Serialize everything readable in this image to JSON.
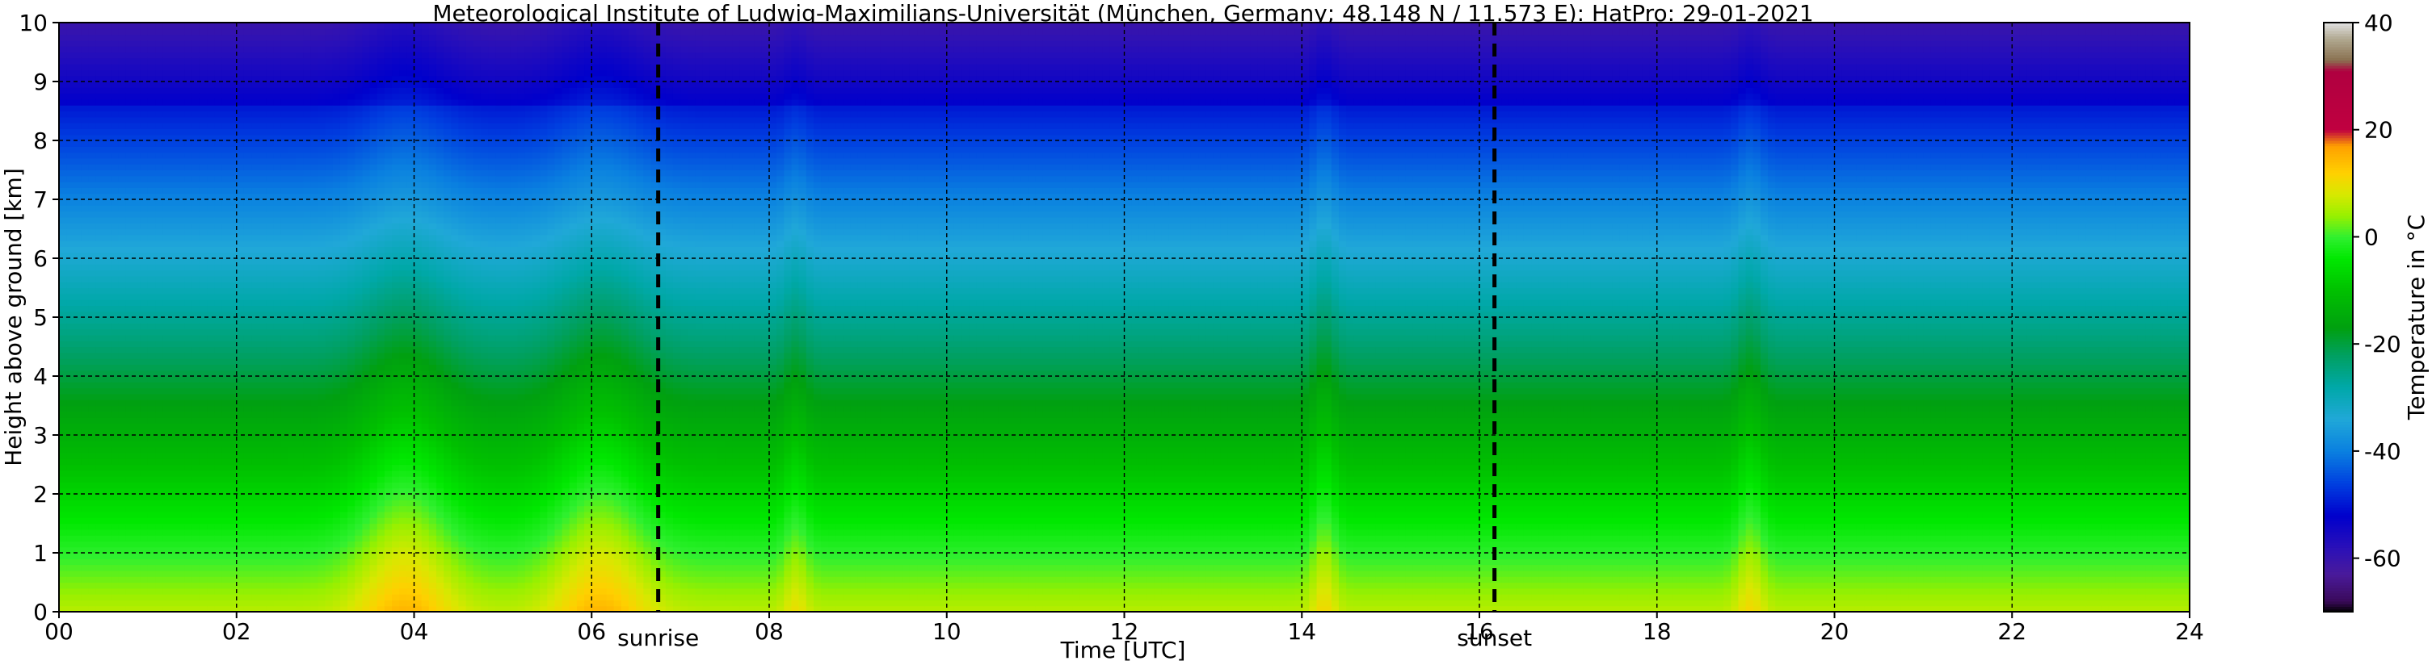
{
  "chart_data": {
    "type": "heatmap",
    "title": "Meteorological Institute of Ludwig-Maximilians-Universität (München, Germany; 48.148 N / 11.573 E):    HatPro: 29-01-2021",
    "xlabel": "Time [UTC]",
    "ylabel": "Height above ground [km]",
    "xlim": [
      0,
      24
    ],
    "ylim": [
      0,
      10
    ],
    "x_ticks": [
      "00",
      "02",
      "04",
      "06",
      "08",
      "10",
      "12",
      "14",
      "16",
      "18",
      "20",
      "22",
      "24"
    ],
    "y_ticks": [
      "0",
      "1",
      "2",
      "3",
      "4",
      "5",
      "6",
      "7",
      "8",
      "9",
      "10"
    ],
    "grid": true,
    "colorbar": {
      "label": "Temperature in °C",
      "range": [
        -70,
        40
      ],
      "ticks": [
        "-60",
        "-40",
        "-20",
        "0",
        "20",
        "40"
      ],
      "colors": [
        {
          "t": -70,
          "c": "#000000"
        },
        {
          "t": -68,
          "c": "#3a0a5a"
        },
        {
          "t": -63,
          "c": "#4a1a9a"
        },
        {
          "t": -58,
          "c": "#2a10b8"
        },
        {
          "t": -52,
          "c": "#0000cc"
        },
        {
          "t": -46,
          "c": "#0040e0"
        },
        {
          "t": -40,
          "c": "#0a80e0"
        },
        {
          "t": -34,
          "c": "#20a8d8"
        },
        {
          "t": -28,
          "c": "#00a8a8"
        },
        {
          "t": -22,
          "c": "#00a060"
        },
        {
          "t": -17,
          "c": "#00a010"
        },
        {
          "t": -10,
          "c": "#00c000"
        },
        {
          "t": -4,
          "c": "#00e800"
        },
        {
          "t": 0,
          "c": "#30f030"
        },
        {
          "t": 4,
          "c": "#98f000"
        },
        {
          "t": 8,
          "c": "#d8e800"
        },
        {
          "t": 12,
          "c": "#ffd000"
        },
        {
          "t": 17,
          "c": "#ffa000"
        },
        {
          "t": 20,
          "c": "#c00040"
        },
        {
          "t": 31,
          "c": "#b00040"
        },
        {
          "t": 33,
          "c": "#8a7050"
        },
        {
          "t": 37,
          "c": "#b0a890"
        },
        {
          "t": 40,
          "c": "#e0e0e0"
        }
      ]
    },
    "annotations": [
      {
        "label": "sunrise",
        "x": 6.75,
        "style": "dashed-vertical-line"
      },
      {
        "label": "sunset",
        "x": 16.17,
        "style": "dashed-vertical-line"
      }
    ],
    "field_model": {
      "description_units": "temperature (°C) vs height (km) and time (hours UTC)",
      "surface_temp_base": 6,
      "lapse_rate_per_km": 6.5,
      "tropopause_km": 8.6,
      "tropopause_temp": -52,
      "warm_events": [
        {
          "time": 3.9,
          "width": 0.55,
          "amplitude": 9,
          "top_km": 6.9
        },
        {
          "time": 6.1,
          "width": 0.55,
          "amplitude": 9,
          "top_km": 6.9
        },
        {
          "time": 8.3,
          "width": 0.15,
          "amplitude": 4,
          "top_km": 9.5
        },
        {
          "time": 14.25,
          "width": 0.15,
          "amplitude": 5,
          "top_km": 9.8
        },
        {
          "time": 19.05,
          "width": 0.17,
          "amplitude": 5,
          "top_km": 9.8
        }
      ]
    }
  }
}
